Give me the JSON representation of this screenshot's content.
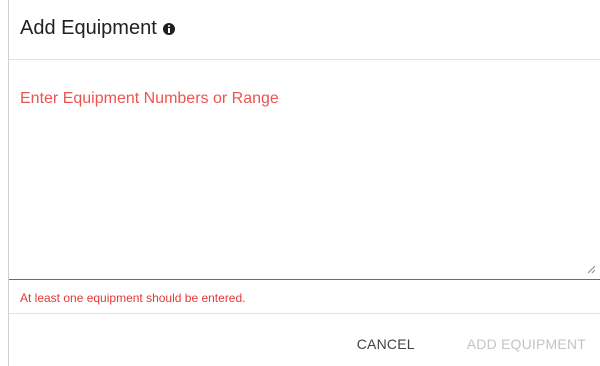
{
  "dialog": {
    "title": "Add Equipment",
    "info_icon": "info-icon",
    "input": {
      "placeholder": "Enter Equipment Numbers or Range",
      "value": ""
    },
    "error": "At least one equipment should be entered.",
    "actions": {
      "cancel_label": "CANCEL",
      "add_label": "ADD EQUIPMENT",
      "add_disabled": true
    }
  },
  "colors": {
    "error": "#e53935",
    "title": "#212121",
    "disabled": "#c4c4c4"
  }
}
